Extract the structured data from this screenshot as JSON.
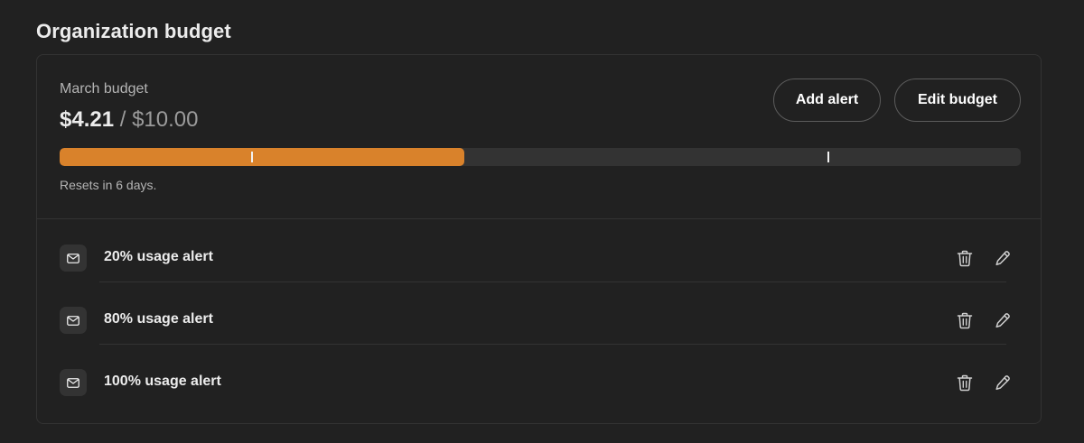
{
  "page": {
    "title": "Organization budget"
  },
  "budget": {
    "label": "March budget",
    "used": "$4.21",
    "separator": " / ",
    "limit": "$10.00",
    "progress_fraction": 0.421,
    "threshold_fractions": [
      0.2,
      0.8
    ],
    "reset_text": "Resets in 6 days.",
    "bar_color": "#d9822b",
    "add_alert_label": "Add alert",
    "edit_budget_label": "Edit budget"
  },
  "alerts": [
    {
      "label": "20% usage alert",
      "icon": "mail-icon"
    },
    {
      "label": "80% usage alert",
      "icon": "mail-icon"
    },
    {
      "label": "100% usage alert",
      "icon": "mail-icon"
    }
  ],
  "icons": {
    "delete": "trash-icon",
    "edit": "pencil-icon"
  }
}
